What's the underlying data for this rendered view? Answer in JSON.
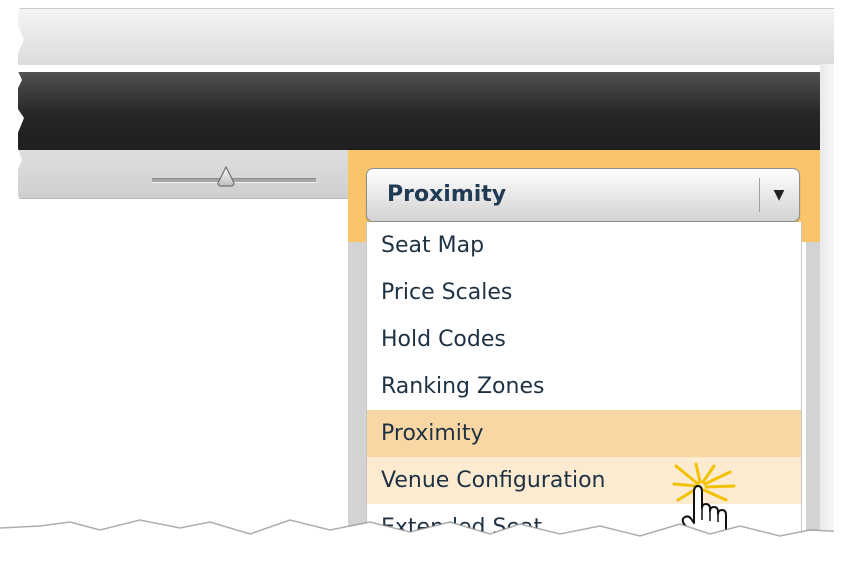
{
  "dropdown": {
    "selected": "Proximity",
    "arrow_glyph": "▼"
  },
  "menu": {
    "items": [
      {
        "label": "Seat Map",
        "state": "normal"
      },
      {
        "label": "Price Scales",
        "state": "normal"
      },
      {
        "label": "Hold Codes",
        "state": "normal"
      },
      {
        "label": "Ranking Zones",
        "state": "normal"
      },
      {
        "label": "Proximity",
        "state": "selected"
      },
      {
        "label": "Venue Configuration",
        "state": "hover"
      },
      {
        "label": "Extended Seat",
        "state": "normal"
      }
    ]
  },
  "slider": {
    "level": 0.45
  },
  "colors": {
    "accent": "#f9c56a",
    "selected_item": "#f9d7a4",
    "hover_item": "#fcebd0",
    "text": "#1e3244"
  },
  "icons": {
    "dropdown": "chevron-down-icon",
    "slider": "slider-thumb-icon",
    "cursor": "hand-pointer-icon"
  }
}
